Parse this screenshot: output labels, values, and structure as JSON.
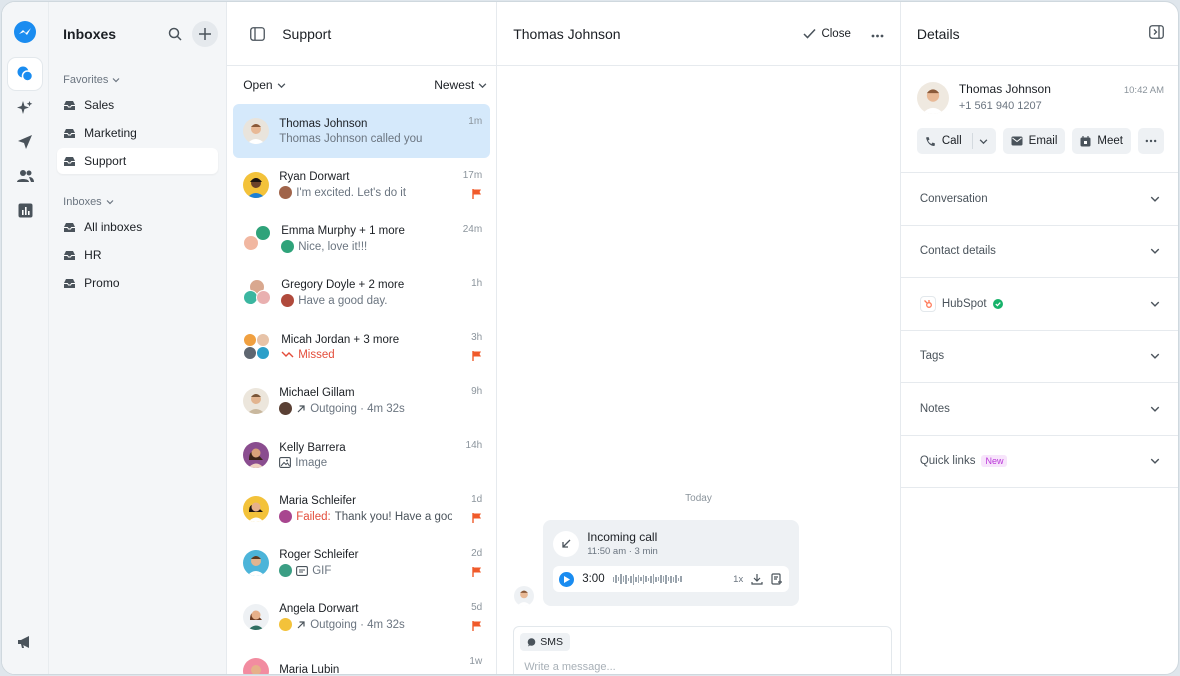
{
  "inboxes": {
    "title": "Inboxes",
    "favorites_label": "Favorites",
    "favorites": [
      {
        "label": "Sales"
      },
      {
        "label": "Marketing"
      },
      {
        "label": "Support",
        "active": true
      }
    ],
    "inboxes_label": "Inboxes",
    "items": [
      {
        "label": "All inboxes"
      },
      {
        "label": "HR"
      },
      {
        "label": "Promo"
      }
    ]
  },
  "list": {
    "title": "Support",
    "filter_status": "Open",
    "filter_sort": "Newest",
    "rows": [
      {
        "name": "Thomas Johnson",
        "preview": "Thomas Johnson called you",
        "time": "1m"
      },
      {
        "name": "Ryan Dorwart",
        "preview": "I'm excited. Let's do it",
        "time": "17m"
      },
      {
        "name": "Emma Murphy + 1 more",
        "preview": "Nice, love it!!!",
        "time": "24m"
      },
      {
        "name": "Gregory Doyle + 2 more",
        "preview": "Have a good day.",
        "time": "1h"
      },
      {
        "name": "Micah Jordan + 3 more",
        "preview": "Missed",
        "time": "3h"
      },
      {
        "name": "Michael Gillam",
        "preview": "Outgoing · 4m 32s",
        "time": "9h"
      },
      {
        "name": "Kelly Barrera",
        "preview": "Image",
        "time": "14h"
      },
      {
        "name": "Maria Schleifer",
        "preview_prefix": "Failed:",
        "preview": "Thank you! Have a goo...",
        "time": "1d"
      },
      {
        "name": "Roger Schleifer",
        "preview": "GIF",
        "time": "2d"
      },
      {
        "name": "Angela Dorwart",
        "preview": "Outgoing · 4m 32s",
        "time": "5d"
      },
      {
        "name": "Maria Lubin",
        "preview": "",
        "time": "1w"
      }
    ]
  },
  "chat": {
    "title": "Thomas Johnson",
    "close_label": "Close",
    "day_label": "Today",
    "call": {
      "title": "Incoming call",
      "meta": "11:50 am · 3 min",
      "duration": "3:00",
      "speed": "1x"
    },
    "composer": {
      "channel": "SMS",
      "placeholder": "Write a message..."
    }
  },
  "details": {
    "title": "Details",
    "contact": {
      "name": "Thomas Johnson",
      "phone": "+1 561 940 1207",
      "time": "10:42 AM"
    },
    "actions": {
      "call": "Call",
      "email": "Email",
      "meet": "Meet"
    },
    "sections": {
      "conversation": "Conversation",
      "contact_details": "Contact details",
      "hubspot": "HubSpot",
      "tags": "Tags",
      "notes": "Notes",
      "quick_links": "Quick links",
      "new_badge": "New"
    }
  },
  "colors": {
    "accent": "#1a8cf0",
    "selected_row": "#d5e9fb",
    "flag": "#f05a2a",
    "hubspot": "#ff7a59",
    "verified": "#17b26a"
  }
}
